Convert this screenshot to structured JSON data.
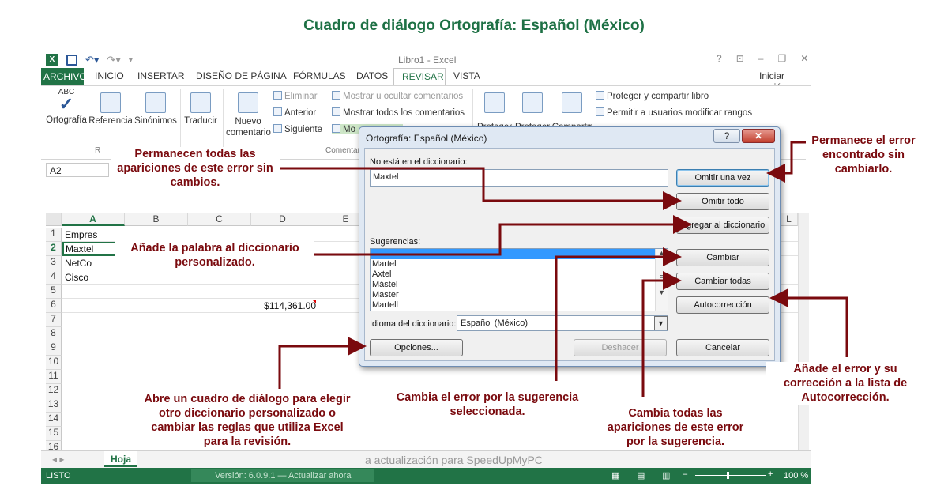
{
  "title": "Cuadro de diálogo Ortografía: Español (México)",
  "excel": {
    "window_title": "Libro1 - Excel",
    "window_controls": [
      "?",
      "⧉",
      "–",
      "🗗",
      "✕"
    ],
    "signin": "Iniciar sesión",
    "tabs": [
      "ARCHIVO",
      "INICIO",
      "INSERTAR",
      "DISEÑO DE PÁGINA",
      "FÓRMULAS",
      "DATOS",
      "REVISAR",
      "VISTA"
    ],
    "ribbon": {
      "ortografia": "Ortografía",
      "referencia": "Referencia",
      "sinonimos": "Sinónimos",
      "traducir": "Traducir",
      "nuevo_comentario": "Nuevo comentario",
      "eliminar": "Eliminar",
      "anterior": "Anterior",
      "siguiente": "Siguiente",
      "mostrar_ocultar": "Mostrar u ocultar comentarios",
      "mostrar_todos": "Mostrar todos los comentarios",
      "mostrar_entrada": "Mo",
      "proteger_libro_small": "Proteger y compartir libro",
      "permitir_usuarios": "Permitir a usuarios modificar rangos",
      "proteger1": "Proteger",
      "proteger2": "Proteger",
      "compartir": "Compartir",
      "group_r": "R",
      "group_comentarios": "Comentar",
      "abc": "ABC"
    },
    "namebox": "A2",
    "columns": [
      "A",
      "B",
      "C",
      "D",
      "E",
      "L"
    ],
    "rows": [
      "1",
      "2",
      "3",
      "4",
      "5",
      "6",
      "7",
      "8",
      "9",
      "10",
      "11",
      "12",
      "13",
      "14",
      "15",
      "16"
    ],
    "cells": {
      "a1": "Empres",
      "a2": "Maxtel",
      "a3": "NetCo",
      "a4": "Cisco",
      "d6": "$114,361.00"
    },
    "sheet_tab": "Hoja",
    "sheet_nav": "◂  ▸",
    "notice": "a actualización para SpeedUpMyPC",
    "version": "Versión: 6.0.9.1 — Actualizar ahora",
    "status": "LISTO",
    "zoom": "100 %"
  },
  "dialog": {
    "title": "Ortografía: Español (México)",
    "help": "?",
    "close": "✕",
    "not_in_dict_label": "No está en el diccionario:",
    "word": "Maxtel",
    "suggestions_label": "Sugerencias:",
    "suggestions": [
      "Maxtel",
      "Martel",
      "Axtel",
      "Mástel",
      "Master",
      "Martell"
    ],
    "language_label": "Idioma del diccionario:",
    "language": "Español (México)",
    "buttons": {
      "ignore_once": "Omitir una vez",
      "ignore_all": "Omitir todo",
      "add_dict": "Agregar al diccionario",
      "change": "Cambiar",
      "change_all": "Cambiar todas",
      "autocorrect": "Autocorrección",
      "options": "Opciones...",
      "undo": "Deshacer",
      "cancel": "Cancelar"
    }
  },
  "callouts": {
    "ignore_all": "Permanecen todas las apariciones de este error sin cambios.",
    "ignore_once": "Permanece el error encontrado sin cambiarlo.",
    "add_dict": "Añade la palabra al diccionario personalizado.",
    "options": "Abre un cuadro de diálogo para elegir otro diccionario personalizado o cambiar las reglas que utiliza Excel para la revisión.",
    "change": "Cambia el error por la sugerencia seleccionada.",
    "change_all": "Cambia todas las apariciones de este error por la sugerencia.",
    "autocorrect": "Añade el error y su corrección a la lista de Autocorrección."
  },
  "colors": {
    "accent": "#217346",
    "callout": "#7a0a0e",
    "title": "#1e7145"
  }
}
